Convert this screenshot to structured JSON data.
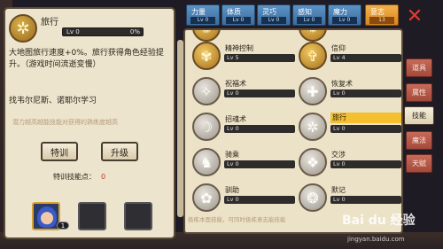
{
  "detail": {
    "name": "旅行",
    "level": "Lv 0",
    "progress_label": "0%",
    "progress": 0,
    "description": "大地图旅行速度+0%。旅行获得角色经验提升。（游戏时间流逝变慢）",
    "requirement": "找韦尔尼斯、诺耶尔学习",
    "hint": "潜力越高越能技能对获得的熟练度越高",
    "train_label": "特训",
    "upgrade_label": "升级",
    "points_label": "特训技能点：",
    "points_value": "0",
    "slot_count": "1"
  },
  "stat_tabs": [
    {
      "name": "力量",
      "value": "Lv 0"
    },
    {
      "name": "体质",
      "value": "Lv 0"
    },
    {
      "name": "灵巧",
      "value": "Lv 0"
    },
    {
      "name": "感知",
      "value": "Lv 0"
    },
    {
      "name": "魔力",
      "value": "Lv 0"
    },
    {
      "name": "意志",
      "value": "13"
    }
  ],
  "close_icon": "close-icon",
  "skills": [
    {
      "name": "",
      "level": "",
      "icon": "spiral-icon",
      "style": "gold"
    },
    {
      "name": "",
      "level": "",
      "icon": "sun-icon",
      "style": "gold"
    },
    {
      "name": "精神控制",
      "level": "Lv 5",
      "icon": "mind-icon",
      "style": "gold"
    },
    {
      "name": "信仰",
      "level": "Lv 4",
      "icon": "faith-icon",
      "style": "gold"
    },
    {
      "name": "祝福术",
      "level": "Lv 0",
      "icon": "blessing-icon",
      "style": "gray"
    },
    {
      "name": "恢复术",
      "level": "Lv 0",
      "icon": "heal-icon",
      "style": "gray"
    },
    {
      "name": "招魂术",
      "level": "Lv 0",
      "icon": "summon-icon",
      "style": "gray"
    },
    {
      "name": "旅行",
      "level": "Lv 0",
      "icon": "wheel-icon",
      "style": "gray",
      "selected": true
    },
    {
      "name": "骑乘",
      "level": "Lv 0",
      "icon": "horse-icon",
      "style": "gray"
    },
    {
      "name": "交涉",
      "level": "Lv 0",
      "icon": "handshake-icon",
      "style": "gray"
    },
    {
      "name": "驯助",
      "level": "Lv 0",
      "icon": "paw-icon",
      "style": "gray"
    },
    {
      "name": "默记",
      "level": "Lv 0",
      "icon": "brain-icon",
      "style": "gray"
    }
  ],
  "grid_note": "极练本面技能，可同时极练意志能技能",
  "side_tabs": [
    {
      "label": "道具",
      "active": false
    },
    {
      "label": "属性",
      "active": false
    },
    {
      "label": "技能",
      "active": true
    },
    {
      "label": "魔法",
      "active": false
    },
    {
      "label": "天赋",
      "active": false
    }
  ],
  "watermark": "Bai du 经验",
  "watermark_url": "jingyan.baidu.com",
  "colors": {
    "accent": "#f4c030",
    "tab_blue": "#4a80b4",
    "tab_active": "#f0a83a",
    "side_tab": "#b85848",
    "close": "#e53a2e"
  }
}
